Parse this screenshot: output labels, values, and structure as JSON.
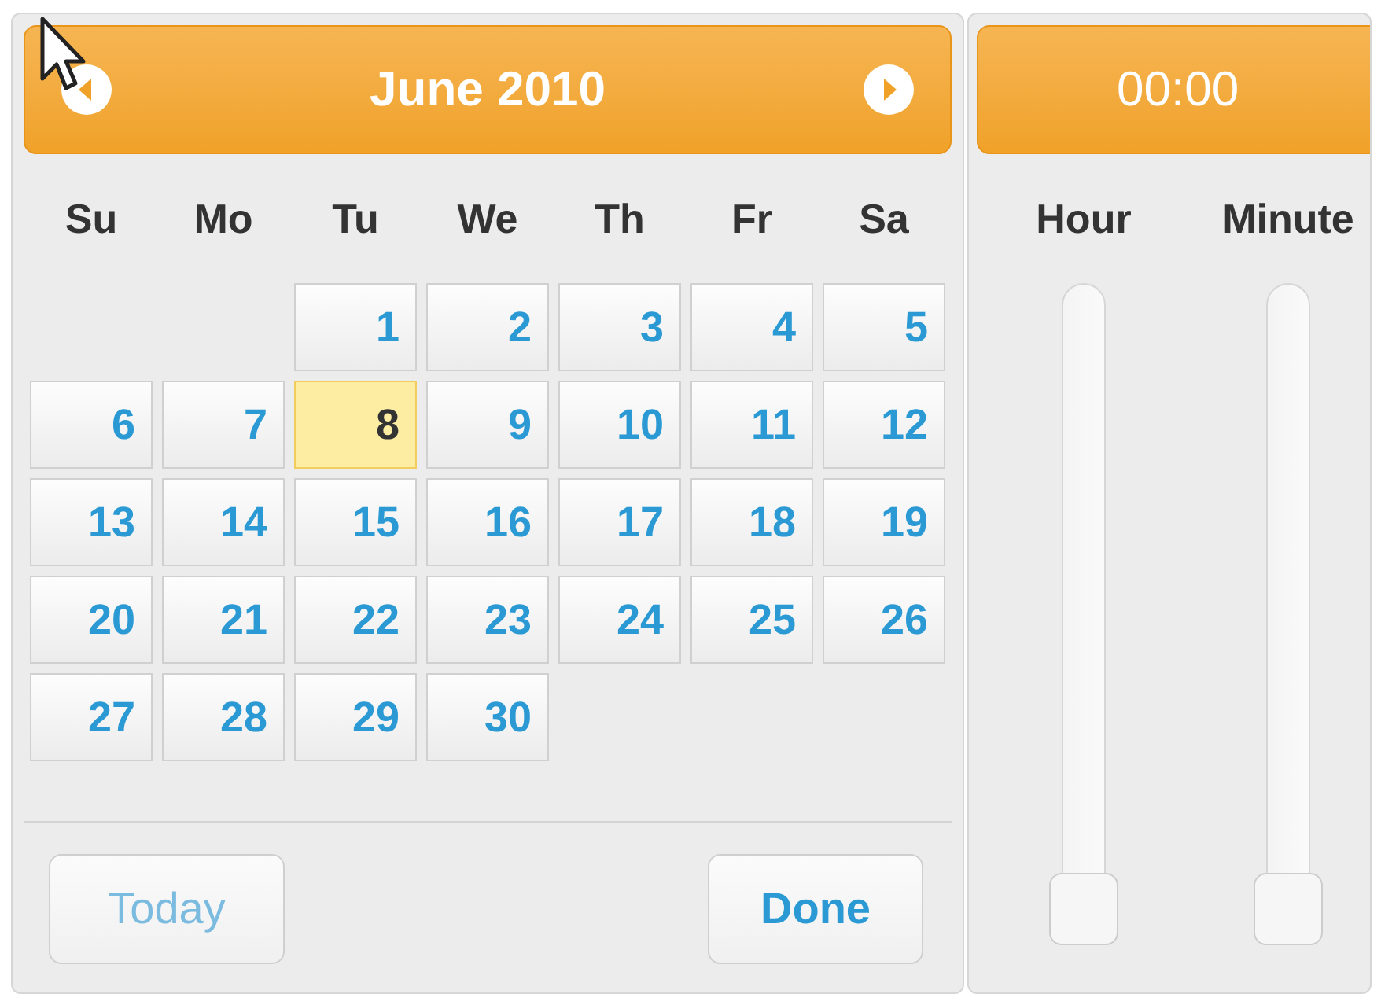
{
  "calendar": {
    "title": "June 2010",
    "weekdays": [
      "Su",
      "Mo",
      "Tu",
      "We",
      "Th",
      "Fr",
      "Sa"
    ],
    "weeks": [
      [
        {
          "kind": "empty"
        },
        {
          "kind": "empty"
        },
        {
          "label": "1",
          "selected": false
        },
        {
          "label": "2",
          "selected": false
        },
        {
          "label": "3",
          "selected": false
        },
        {
          "label": "4",
          "selected": false
        },
        {
          "label": "5",
          "selected": false
        }
      ],
      [
        {
          "label": "6",
          "selected": false
        },
        {
          "label": "7",
          "selected": false
        },
        {
          "label": "8",
          "selected": true
        },
        {
          "label": "9",
          "selected": false
        },
        {
          "label": "10",
          "selected": false
        },
        {
          "label": "11",
          "selected": false
        },
        {
          "label": "12",
          "selected": false
        }
      ],
      [
        {
          "label": "13",
          "selected": false
        },
        {
          "label": "14",
          "selected": false
        },
        {
          "label": "15",
          "selected": false
        },
        {
          "label": "16",
          "selected": false
        },
        {
          "label": "17",
          "selected": false
        },
        {
          "label": "18",
          "selected": false
        },
        {
          "label": "19",
          "selected": false
        }
      ],
      [
        {
          "label": "20",
          "selected": false
        },
        {
          "label": "21",
          "selected": false
        },
        {
          "label": "22",
          "selected": false
        },
        {
          "label": "23",
          "selected": false
        },
        {
          "label": "24",
          "selected": false
        },
        {
          "label": "25",
          "selected": false
        },
        {
          "label": "26",
          "selected": false
        }
      ],
      [
        {
          "label": "27",
          "selected": false
        },
        {
          "label": "28",
          "selected": false
        },
        {
          "label": "29",
          "selected": false
        },
        {
          "label": "30",
          "selected": false
        },
        {
          "kind": "empty"
        },
        {
          "kind": "empty"
        },
        {
          "kind": "empty"
        }
      ]
    ],
    "buttons": [
      {
        "label": "Today",
        "disabled": true
      },
      {
        "label": "Done",
        "disabled": false
      }
    ]
  },
  "time": {
    "title": "00:00",
    "sliders": [
      {
        "label": "Hour",
        "level": 0
      },
      {
        "label": "Minute",
        "level": 0
      }
    ]
  }
}
